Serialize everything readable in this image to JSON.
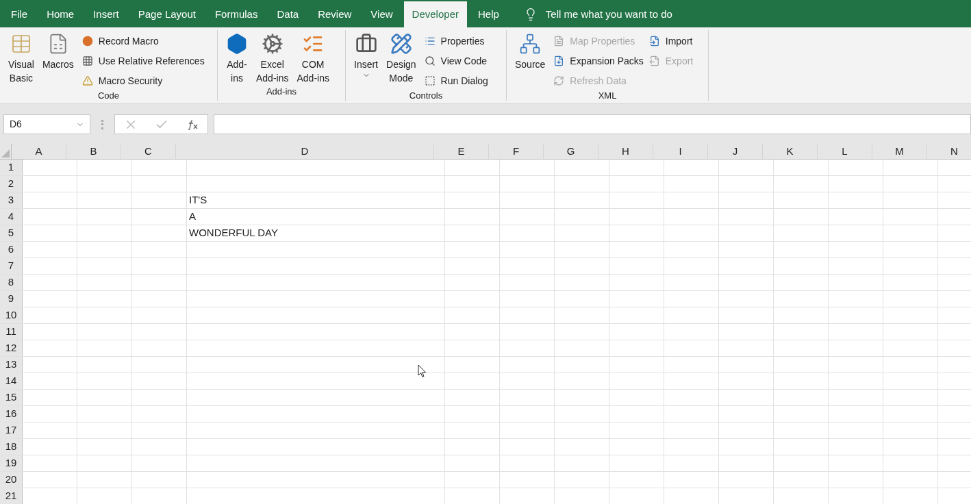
{
  "menu_tabs": [
    {
      "label": "File",
      "selected": false
    },
    {
      "label": "Home",
      "selected": false
    },
    {
      "label": "Insert",
      "selected": false
    },
    {
      "label": "Page Layout",
      "selected": false
    },
    {
      "label": "Formulas",
      "selected": false
    },
    {
      "label": "Data",
      "selected": false
    },
    {
      "label": "Review",
      "selected": false
    },
    {
      "label": "View",
      "selected": false
    },
    {
      "label": "Developer",
      "selected": true
    },
    {
      "label": "Help",
      "selected": false
    }
  ],
  "tell_me": "Tell me what you want to do",
  "ribbon": {
    "groups": [
      {
        "label": "Code",
        "items": [
          {
            "kind": "large",
            "lines": [
              "Visual",
              "Basic"
            ]
          },
          {
            "kind": "large",
            "lines": [
              "Macros"
            ]
          },
          {
            "kind": "small-column",
            "items": [
              {
                "label": "Record Macro",
                "disabled": false
              },
              {
                "label": "Use Relative References",
                "disabled": false
              },
              {
                "label": "Macro Security",
                "disabled": false
              }
            ]
          }
        ]
      },
      {
        "label": "Add-ins",
        "items": [
          {
            "kind": "large",
            "lines": [
              "Add-",
              "ins"
            ]
          },
          {
            "kind": "large",
            "lines": [
              "Excel",
              "Add-ins"
            ]
          },
          {
            "kind": "large",
            "lines": [
              "COM",
              "Add-ins"
            ]
          }
        ]
      },
      {
        "label": "Controls",
        "items": [
          {
            "kind": "large",
            "lines": [
              "Insert"
            ],
            "dropdown": true
          },
          {
            "kind": "large",
            "lines": [
              "Design",
              "Mode"
            ]
          },
          {
            "kind": "small-column",
            "items": [
              {
                "label": "Properties",
                "disabled": false
              },
              {
                "label": "View Code",
                "disabled": false
              },
              {
                "label": "Run Dialog",
                "disabled": false
              }
            ]
          }
        ]
      },
      {
        "label": "XML",
        "items": [
          {
            "kind": "large",
            "lines": [
              "Source"
            ]
          },
          {
            "kind": "small-column",
            "items": [
              {
                "label": "Map Properties",
                "disabled": true
              },
              {
                "label": "Expansion Packs",
                "disabled": false
              },
              {
                "label": "Refresh Data",
                "disabled": true
              }
            ]
          },
          {
            "kind": "small-column",
            "items": [
              {
                "label": "Import",
                "disabled": false
              },
              {
                "label": "Export",
                "disabled": true
              }
            ]
          }
        ]
      }
    ]
  },
  "formula_bar": {
    "name_box": "D6"
  },
  "grid": {
    "columns": [
      "A",
      "B",
      "C",
      "D",
      "E",
      "F",
      "G",
      "H",
      "I",
      "J",
      "K",
      "L",
      "M",
      "N"
    ],
    "rows": [
      {
        "label": "1"
      },
      {
        "label": "2"
      },
      {
        "label": "3",
        "column_4": "IT'S"
      },
      {
        "label": "4",
        "column_4": "A"
      },
      {
        "label": "5",
        "column_4": "WONDERFUL DAY"
      },
      {
        "label": "6"
      },
      {
        "label": "7"
      },
      {
        "label": "8"
      },
      {
        "label": "9"
      },
      {
        "label": "10"
      },
      {
        "label": "11"
      },
      {
        "label": "12"
      },
      {
        "label": "13"
      },
      {
        "label": "14"
      },
      {
        "label": "15"
      },
      {
        "label": "16"
      },
      {
        "label": "17"
      },
      {
        "label": "18"
      },
      {
        "label": "19"
      },
      {
        "label": "20"
      },
      {
        "label": "21"
      }
    ]
  }
}
